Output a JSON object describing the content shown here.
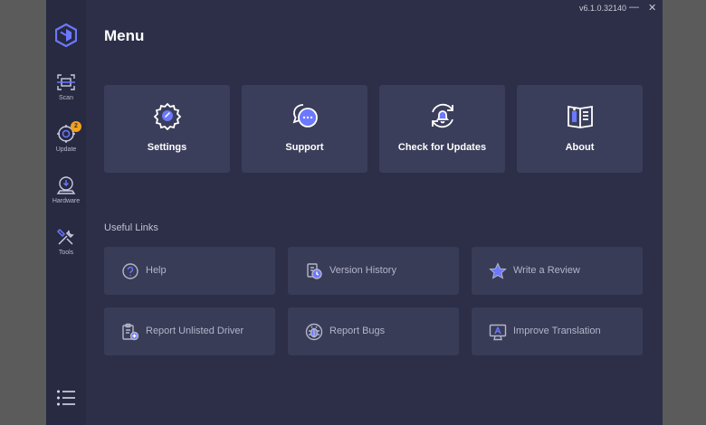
{
  "app": {
    "version": "v6.1.0.32140",
    "controls": {
      "minimize": "—",
      "close": "✕"
    }
  },
  "sidebar": {
    "items": [
      {
        "label": "Scan",
        "icon": "scan-icon"
      },
      {
        "label": "Update",
        "icon": "update-icon",
        "badge": "2"
      },
      {
        "label": "Hardware",
        "icon": "hardware-icon"
      },
      {
        "label": "Tools",
        "icon": "tools-icon"
      }
    ]
  },
  "page": {
    "title": "Menu"
  },
  "cards": [
    {
      "label": "Settings",
      "icon": "gear-icon"
    },
    {
      "label": "Support",
      "icon": "chat-icon"
    },
    {
      "label": "Check for Updates",
      "icon": "bell-refresh-icon"
    },
    {
      "label": "About",
      "icon": "info-book-icon"
    }
  ],
  "useful_links": {
    "title": "Useful Links",
    "items": [
      {
        "label": "Help",
        "icon": "help-icon"
      },
      {
        "label": "Version History",
        "icon": "history-icon"
      },
      {
        "label": "Write a Review",
        "icon": "star-icon"
      },
      {
        "label": "Report Unlisted Driver",
        "icon": "clipboard-add-icon"
      },
      {
        "label": "Report Bugs",
        "icon": "bug-icon"
      },
      {
        "label": "Improve Translation",
        "icon": "translate-icon"
      }
    ]
  },
  "colors": {
    "accent": "#6b78ff",
    "badge": "#f3a21c",
    "background": "#2c2f47",
    "sidebar": "#272a40",
    "card": "#3b3e5a"
  }
}
